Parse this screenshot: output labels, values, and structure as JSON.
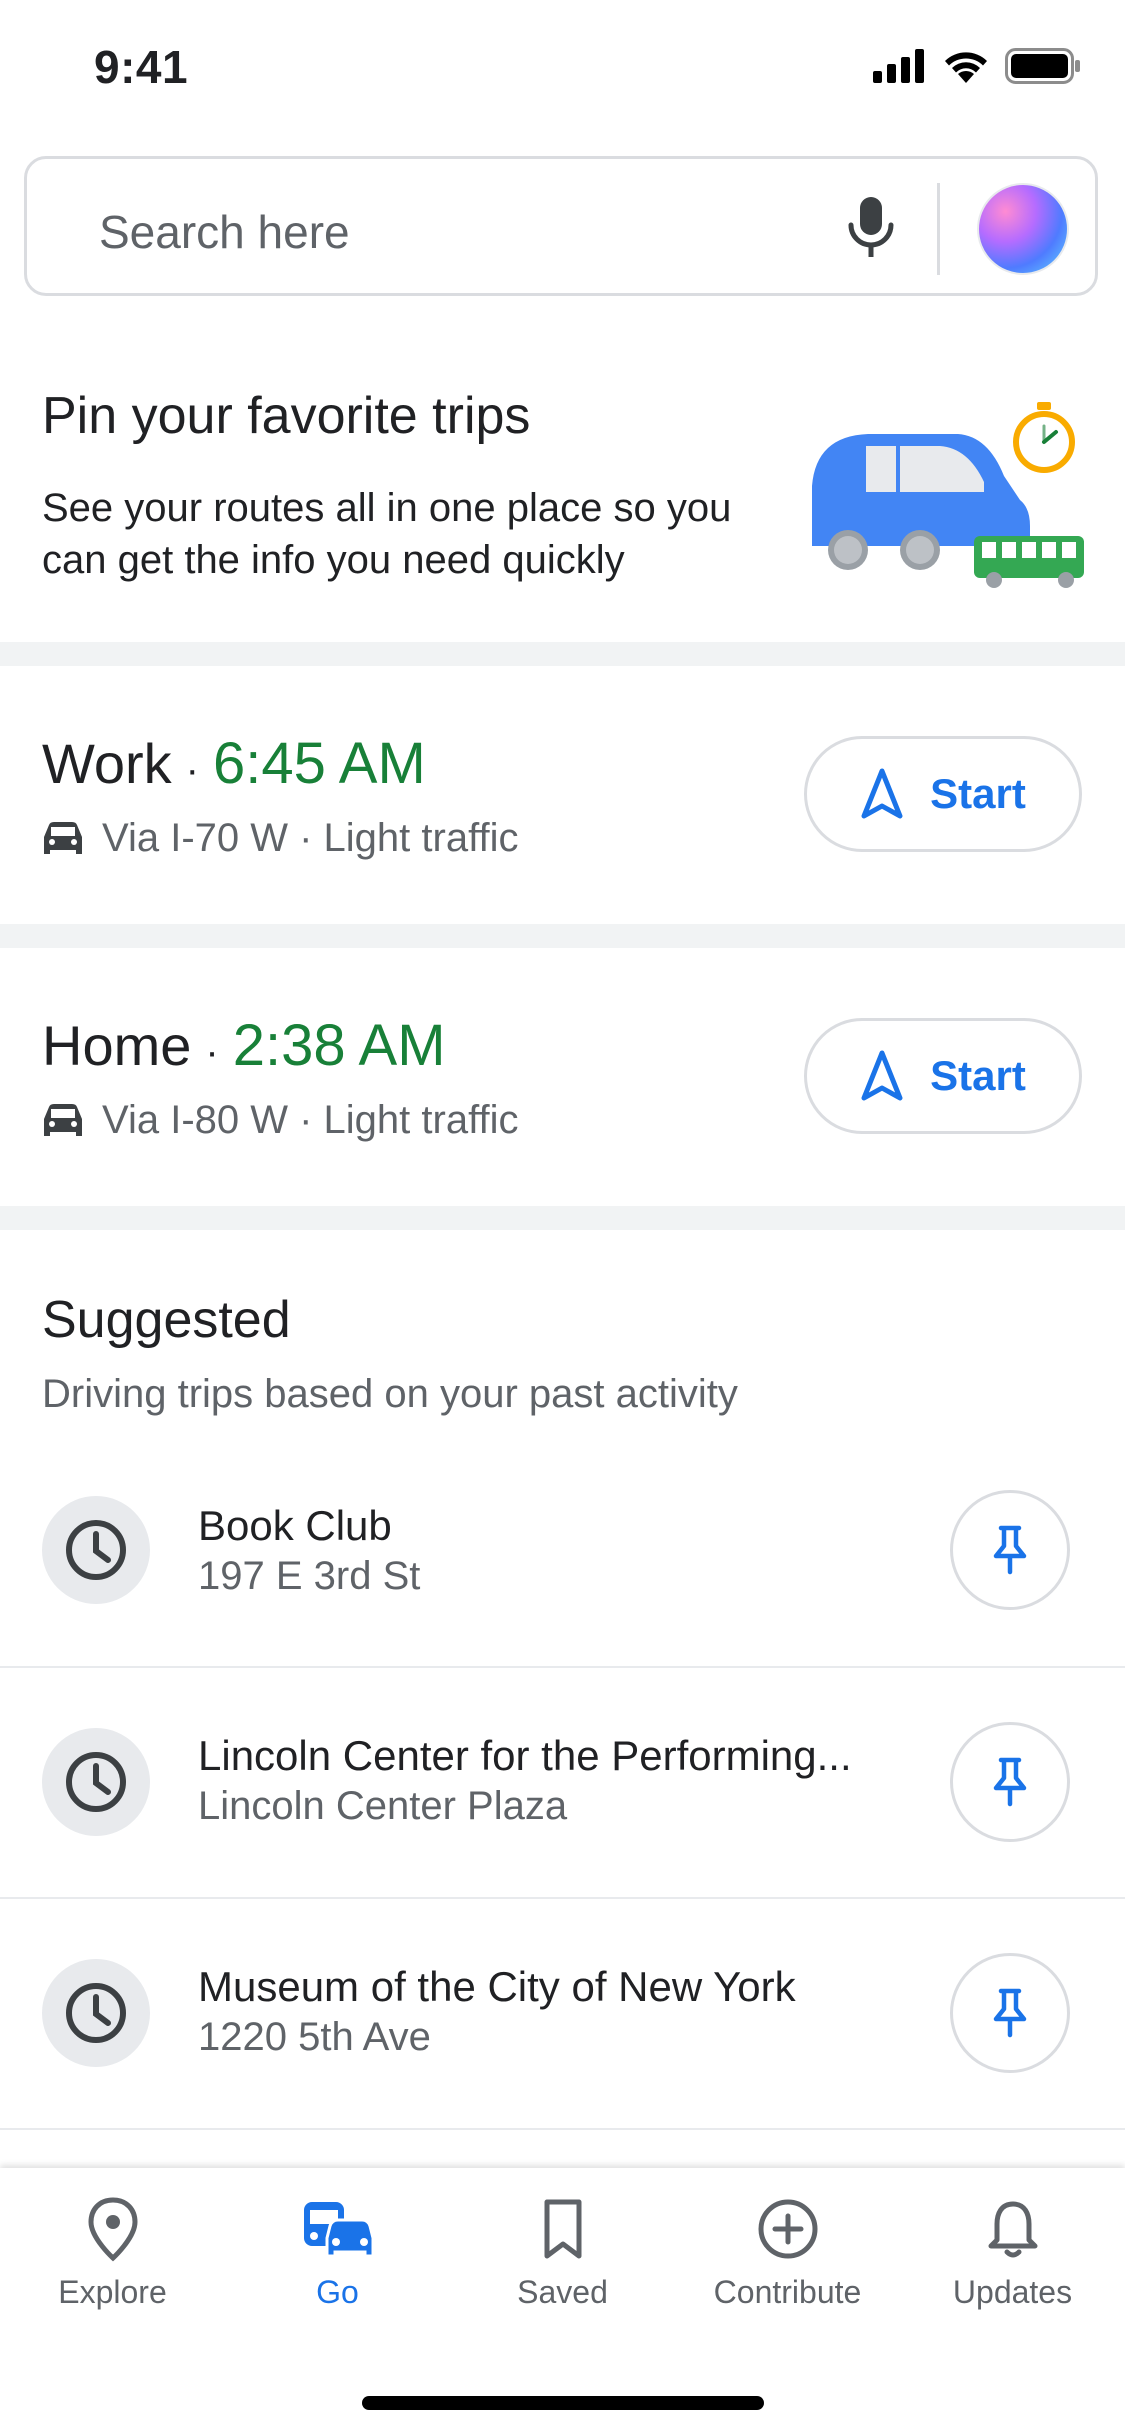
{
  "status_bar": {
    "time": "9:41"
  },
  "search": {
    "placeholder": "Search here"
  },
  "promo": {
    "title": "Pin your favorite trips",
    "body": "See your routes all in one place so you can get the info you need quickly"
  },
  "trips": [
    {
      "name": "Work",
      "separator": "·",
      "time": "6:45 AM",
      "route": "Via I-70 W · Light traffic",
      "action": "Start"
    },
    {
      "name": "Home",
      "separator": "·",
      "time": "2:38 AM",
      "route": "Via I-80 W · Light traffic",
      "action": "Start"
    }
  ],
  "suggested": {
    "title": "Suggested",
    "subtitle": "Driving trips based on your past activity",
    "items": [
      {
        "name": "Book Club",
        "address": "197 E 3rd St"
      },
      {
        "name": "Lincoln Center for the Performing...",
        "address": "Lincoln Center Plaza"
      },
      {
        "name": "Museum of the City of New York",
        "address": "1220 5th Ave"
      }
    ]
  },
  "nav": {
    "items": [
      {
        "label": "Explore",
        "icon": "location-pin-icon",
        "active": false
      },
      {
        "label": "Go",
        "icon": "commute-icon",
        "active": true
      },
      {
        "label": "Saved",
        "icon": "bookmark-icon",
        "active": false
      },
      {
        "label": "Contribute",
        "icon": "add-circle-icon",
        "active": false
      },
      {
        "label": "Updates",
        "icon": "bell-icon",
        "active": false
      }
    ]
  },
  "colors": {
    "accent": "#1a73e8",
    "time_green": "#188038",
    "muted": "#5f6368",
    "band": "#f1f3f4"
  }
}
